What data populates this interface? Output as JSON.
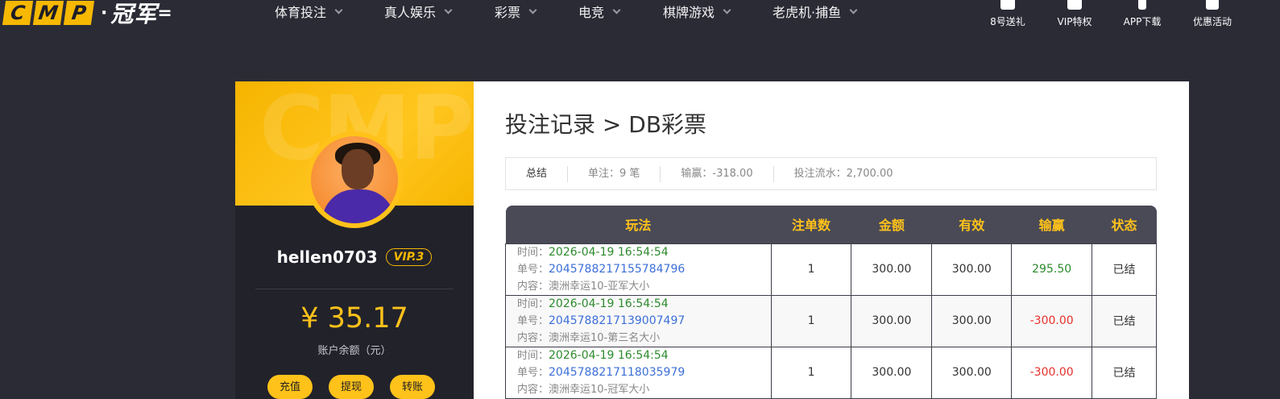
{
  "logo": {
    "letters": [
      "C",
      "M",
      "P"
    ],
    "separator": "·",
    "cn": "冠军",
    "suffix": "="
  },
  "nav": [
    "体育投注",
    "真人娱乐",
    "彩票",
    "电竞",
    "棋牌游戏",
    "老虎机·捕鱼"
  ],
  "quick_links": [
    "8号送礼",
    "VIP特权",
    "APP下载",
    "优惠活动"
  ],
  "user": {
    "watermark": "CMP",
    "username": "hellen0703",
    "vip": "VIP.3",
    "balance": "¥ 35.17",
    "balance_label": "账户余额（元）",
    "actions": [
      "充值",
      "提现",
      "转账"
    ]
  },
  "page": {
    "title": "投注记录 > DB彩票",
    "summary": {
      "label": "总结",
      "count": "单注：9 笔",
      "profit": "输赢：-318.00",
      "turnover": "投注流水：2,700.00"
    }
  },
  "table": {
    "headers": [
      "玩法",
      "注单数",
      "金额",
      "有效",
      "输赢",
      "状态"
    ],
    "labels": {
      "time": "时间：",
      "id": "单号：",
      "content": "内容："
    },
    "rows": [
      {
        "time": "2026-04-19 16:54:54",
        "id": "2045788217155784796",
        "content": "澳洲幸运10-亚军大小",
        "count": "1",
        "amount": "300.00",
        "valid": "300.00",
        "result": "295.50",
        "status": "已结"
      },
      {
        "time": "2026-04-19 16:54:54",
        "id": "2045788217139007497",
        "content": "澳洲幸运10-第三名大小",
        "count": "1",
        "amount": "300.00",
        "valid": "300.00",
        "result": "-300.00",
        "status": "已结"
      },
      {
        "time": "2026-04-19 16:54:54",
        "id": "2045788217118035979",
        "content": "澳洲幸运10-冠军大小",
        "count": "1",
        "amount": "300.00",
        "valid": "300.00",
        "result": "-300.00",
        "status": "已结"
      }
    ]
  }
}
